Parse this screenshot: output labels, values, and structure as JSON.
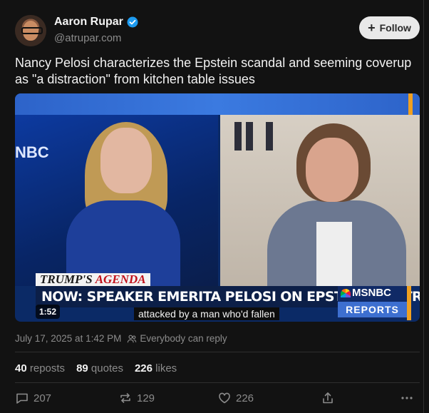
{
  "author": {
    "name": "Aaron Rupar",
    "handle": "@atrupar.com",
    "verified_icon": "verified-badge-icon"
  },
  "follow_button": {
    "label": "Follow"
  },
  "tweet": {
    "text": "Nancy Pelosi characterizes the Epstein scandal and seeming coverup as \"a distraction\" from kitchen table issues"
  },
  "video": {
    "agenda_prefix": "TRUMP'S",
    "agenda_word": "AGENDA",
    "headline": "NOW: SPEAKER EMERITA PELOSI ON EPSTEIN CONTROVERSY",
    "network": "MSNBC",
    "network_sub": "REPORTS",
    "side_logo": "NBC",
    "caption": "attacked by a man who'd fallen",
    "duration": "1:52"
  },
  "meta": {
    "timestamp": "July 17, 2025 at 1:42 PM",
    "reply_setting": "Everybody can reply"
  },
  "stats": {
    "reposts_count": "40",
    "reposts_label": "reposts",
    "quotes_count": "89",
    "quotes_label": "quotes",
    "likes_count": "226",
    "likes_label": "likes"
  },
  "actions": {
    "replies": "207",
    "reposts": "129",
    "likes": "226"
  },
  "colors": {
    "background": "#121212",
    "verified": "#1d9bf0",
    "muted": "#8b8b8b"
  }
}
